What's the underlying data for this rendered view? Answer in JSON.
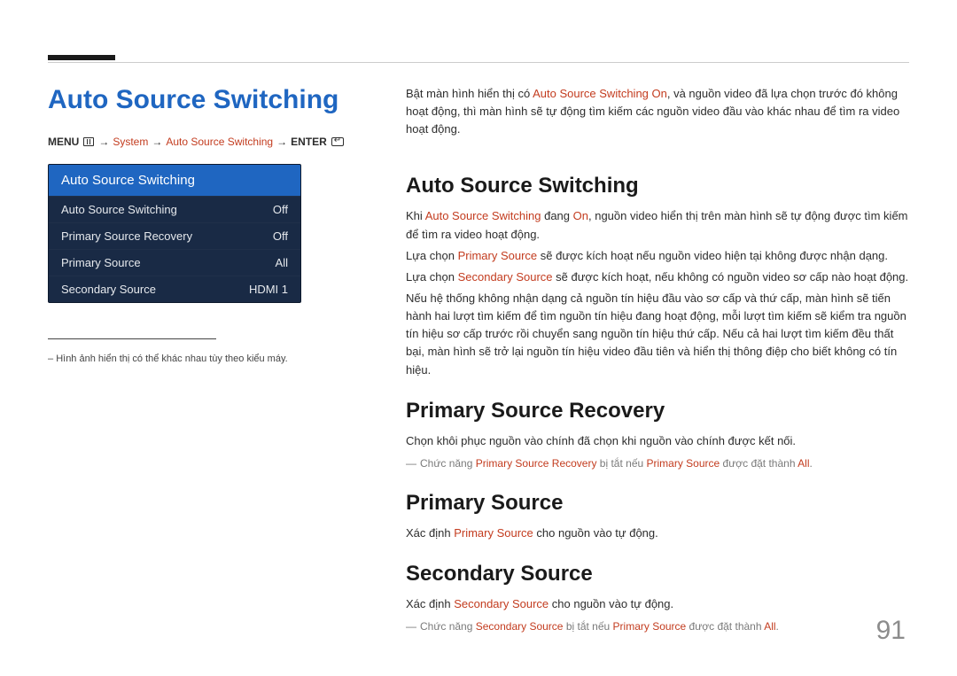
{
  "left": {
    "title": "Auto Source Switching",
    "breadcrumb": {
      "menu": "MENU",
      "arrow": "→",
      "system": "System",
      "item": "Auto Source Switching",
      "enter": "ENTER"
    },
    "menu": {
      "header": "Auto Source Switching",
      "rows": [
        {
          "label": "Auto Source Switching",
          "value": "Off"
        },
        {
          "label": "Primary Source Recovery",
          "value": "Off"
        },
        {
          "label": "Primary Source",
          "value": "All"
        },
        {
          "label": "Secondary Source",
          "value": "HDMI 1"
        }
      ]
    },
    "footnote_dash": "–",
    "footnote": "Hình ảnh hiển thị có thể khác nhau tùy theo kiểu máy."
  },
  "right": {
    "intro": {
      "t1": "Bật màn hình hiển thị có ",
      "h1": "Auto Source Switching On",
      "t2": ", và nguồn video đã lựa chọn trước đó không hoạt động, thì màn hình sẽ tự động tìm kiếm các nguồn video đầu vào khác nhau để tìm ra video hoạt động."
    },
    "s1": {
      "heading": "Auto Source Switching",
      "p1": {
        "t1": "Khi ",
        "h1": "Auto Source Switching",
        "t2": " đang ",
        "h2": "On",
        "t3": ", nguồn video hiển thị trên màn hình sẽ tự động được tìm kiếm để tìm ra video hoạt động."
      },
      "p2": {
        "t1": "Lựa chọn ",
        "h1": "Primary Source",
        "t2": " sẽ được kích hoạt nếu nguồn video hiện tại không được nhận dạng."
      },
      "p3": {
        "t1": "Lựa chọn ",
        "h1": "Secondary Source",
        "t2": " sẽ được kích hoạt, nếu không có nguồn video sơ cấp nào hoạt động."
      },
      "p4": "Nếu hệ thống không nhận dạng cả nguồn tín hiệu đầu vào sơ cấp và thứ cấp, màn hình sẽ tiến hành hai lượt tìm kiếm để tìm nguồn tín hiệu đang hoạt động, mỗi lượt tìm kiếm sẽ kiểm tra nguồn tín hiệu sơ cấp trước rồi chuyển sang nguồn tín hiệu thứ cấp. Nếu cả hai lượt tìm kiếm đều thất bại, màn hình sẽ trở lại nguồn tín hiệu video đầu tiên và hiển thị thông điệp cho biết không có tín hiệu."
    },
    "s2": {
      "heading": "Primary Source Recovery",
      "p1": "Chọn khôi phục nguồn vào chính đã chọn khi nguồn vào chính được kết nối.",
      "note": {
        "t1": "Chức năng ",
        "h1": "Primary Source Recovery",
        "t2": " bị tắt nếu ",
        "h2": "Primary Source",
        "t3": " được đặt thành ",
        "h3": "All",
        "t4": "."
      }
    },
    "s3": {
      "heading": "Primary Source",
      "p1": {
        "t1": "Xác định ",
        "h1": "Primary Source",
        "t2": " cho nguồn vào tự động."
      }
    },
    "s4": {
      "heading": "Secondary Source",
      "p1": {
        "t1": "Xác định ",
        "h1": "Secondary Source",
        "t2": " cho nguồn vào tự động."
      },
      "note": {
        "t1": "Chức năng ",
        "h1": "Secondary Source",
        "t2": " bị tắt nếu ",
        "h2": "Primary Source",
        "t3": " được đặt thành ",
        "h3": "All",
        "t4": "."
      }
    }
  },
  "page_number": "91"
}
